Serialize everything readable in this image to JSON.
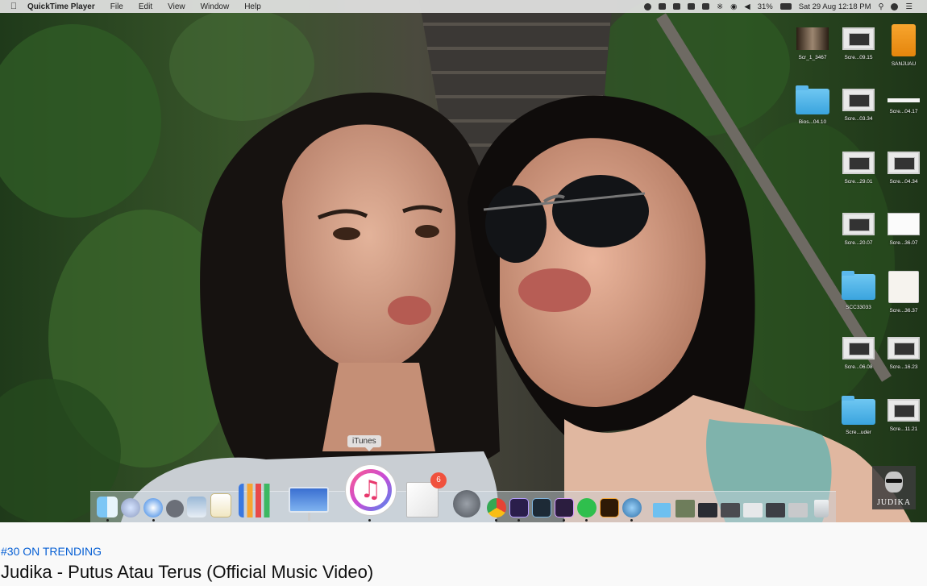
{
  "menubar": {
    "app_name": "QuickTime Player",
    "items": [
      "File",
      "Edit",
      "View",
      "Window",
      "Help"
    ],
    "battery": "31%",
    "datetime": "Sat 29 Aug  12:18 PM"
  },
  "desktop_icons": [
    {
      "label": "Scr_1_3467",
      "kind": "photo"
    },
    {
      "label": "Scre...09.15",
      "kind": "thumb"
    },
    {
      "label": "SANJUAU",
      "kind": "drive"
    },
    {
      "label": "Bios...04.10",
      "kind": "folder"
    },
    {
      "label": "Scre...03.34",
      "kind": "thumb"
    },
    {
      "label": "Scre...04.17",
      "kind": "line"
    },
    {
      "label": "Scre...29.01",
      "kind": "thumb"
    },
    {
      "label": "Scre...04.34",
      "kind": "thumb"
    },
    {
      "label": "Scre...20.07",
      "kind": "thumb"
    },
    {
      "label": "Scre...36.07",
      "kind": "doc"
    },
    {
      "label": "SCC33033",
      "kind": "folder"
    },
    {
      "label": "Scre...36.37",
      "kind": "seal"
    },
    {
      "label": "Scre...06.08",
      "kind": "thumb"
    },
    {
      "label": "Scre...16.23",
      "kind": "thumb"
    },
    {
      "label": "Scre...uder",
      "kind": "folder"
    },
    {
      "label": "Scre...11.21",
      "kind": "thumb"
    }
  ],
  "dock": {
    "tooltip": "iTunes",
    "badge": "6",
    "apps": [
      "finder-icon",
      "siri-icon",
      "safari-icon",
      "launchpad-icon",
      "preview-icon",
      "textedit-icon",
      "numbers-icon",
      "keynote-icon",
      "itunes-icon",
      "font-book-icon",
      "system-preferences-icon",
      "chrome-icon",
      "after-effects-icon",
      "lightroom-icon",
      "premiere-icon",
      "whatsapp-icon",
      "illustrator-icon",
      "quicktime-icon"
    ]
  },
  "watermark": "JUDIKA",
  "video": {
    "trending": "#30 ON TRENDING",
    "title": "Judika - Putus Atau Terus (Official Music Video)"
  },
  "colors": {
    "trending": "#065fd4",
    "title": "#0f0f0f",
    "page_bg": "#f9f9f9"
  }
}
